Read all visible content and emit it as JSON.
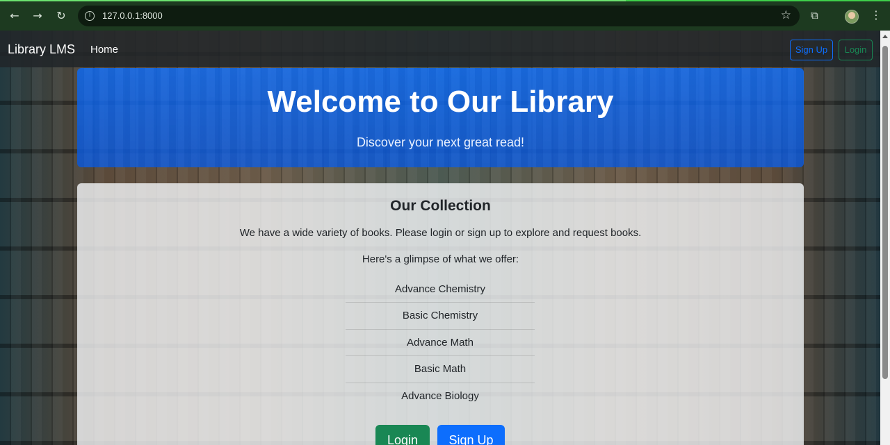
{
  "browser": {
    "url": "127.0.0.1:8000",
    "back_icon": "←",
    "forward_icon": "→",
    "reload_icon": "↻",
    "info_icon": "i",
    "star_icon": "☆",
    "extensions_icon": "⧉",
    "menu_icon": "⋮"
  },
  "navbar": {
    "brand": "Library LMS",
    "home": "Home",
    "signup": "Sign Up",
    "login": "Login"
  },
  "hero": {
    "title": "Welcome to Our Library",
    "subtitle": "Discover your next great read!"
  },
  "collection": {
    "heading": "Our Collection",
    "description": "We have a wide variety of books. Please login or sign up to explore and request books.",
    "glimpse": "Here's a glimpse of what we offer:",
    "books": [
      "Advance Chemistry",
      "Basic Chemistry",
      "Advance Math",
      "Basic Math",
      "Advance Biology"
    ],
    "login_button": "Login",
    "signup_button": "Sign Up"
  },
  "colors": {
    "primary": "#0d6efd",
    "success": "#198754",
    "navbar": "#212529"
  }
}
